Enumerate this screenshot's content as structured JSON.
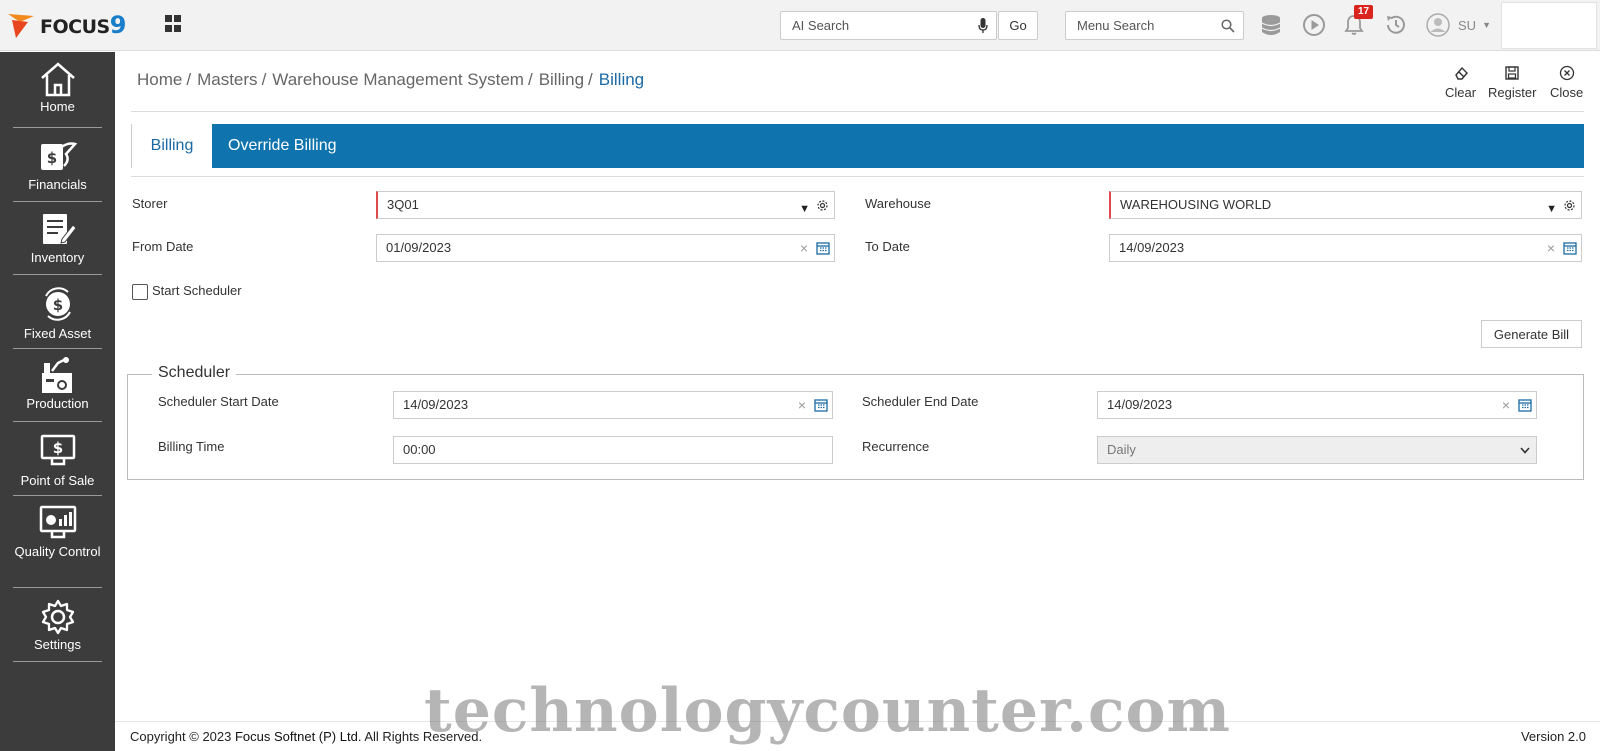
{
  "brand": {
    "logo_text": "FOCUS",
    "logo_number": "9"
  },
  "topbar": {
    "ai_search_placeholder": "AI Search",
    "go_label": "Go",
    "menu_search_placeholder": "Menu Search",
    "notification_count": "17",
    "user_initials": "SU"
  },
  "sidebar": {
    "items": [
      {
        "label": "Home",
        "icon": "home-icon"
      },
      {
        "label": "Financials",
        "icon": "financials-icon"
      },
      {
        "label": "Inventory",
        "icon": "inventory-icon"
      },
      {
        "label": "Fixed Asset",
        "icon": "fixed-asset-icon"
      },
      {
        "label": "Production",
        "icon": "production-icon"
      },
      {
        "label": "Point of Sale",
        "icon": "point-of-sale-icon"
      },
      {
        "label": "Quality Control",
        "icon": "quality-control-icon"
      },
      {
        "label": "Settings",
        "icon": "gear-icon"
      }
    ]
  },
  "breadcrumb": {
    "items": [
      "Home",
      "Masters",
      "Warehouse Management System",
      "Billing"
    ],
    "current": "Billing"
  },
  "actions": {
    "clear": "Clear",
    "register": "Register",
    "close": "Close"
  },
  "tabs": [
    "Billing",
    "Override Billing"
  ],
  "form": {
    "storer_label": "Storer",
    "storer_value": "3Q01",
    "warehouse_label": "Warehouse",
    "warehouse_value": "WAREHOUSING WORLD",
    "from_date_label": "From Date",
    "from_date_value": "01/09/2023",
    "to_date_label": "To Date",
    "to_date_value": "14/09/2023",
    "start_scheduler_label": "Start Scheduler",
    "generate_bill_label": "Generate Bill"
  },
  "scheduler": {
    "legend": "Scheduler",
    "start_date_label": "Scheduler Start Date",
    "start_date_value": "14/09/2023",
    "end_date_label": "Scheduler End Date",
    "end_date_value": "14/09/2023",
    "billing_time_label": "Billing Time",
    "billing_time_value": "00:00",
    "recurrence_label": "Recurrence",
    "recurrence_value": "Daily"
  },
  "footer": {
    "copyright_prefix": "Copyright © 2023",
    "company": "Focus Softnet (P) Ltd.",
    "rights": "All Rights Reserved.",
    "version": "Version 2.0"
  },
  "watermark": "technologycounter.com",
  "colors": {
    "accent": "#0f73ad",
    "sidebar_bg": "#3c3c3c",
    "required": "#e04a4a",
    "badge": "#d9251d"
  }
}
